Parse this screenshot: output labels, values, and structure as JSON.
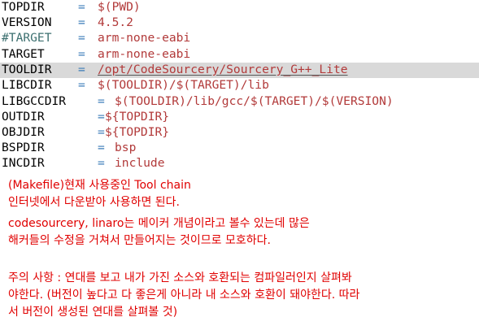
{
  "colors": {
    "variable": "#000000",
    "comment": "#3d7070",
    "operator": "#3a7bb8",
    "value": "#b23a3a",
    "highlight": "#d9d9d9",
    "note_text": "#e00000"
  },
  "editor": {
    "lines": [
      {
        "name": "TOPDIR",
        "op": "=",
        "value": "$(PWD)"
      },
      {
        "name": "VERSION",
        "op": "=",
        "value": "4.5.2"
      },
      {
        "name": "#TARGET",
        "op": "=",
        "value": "arm-none-eabi",
        "comment": true
      },
      {
        "name": "TARGET",
        "op": "=",
        "value": "arm-none-eabi"
      },
      {
        "name": "TOOLDIR",
        "op": "=",
        "value": "/opt/CodeSourcery/Sourcery_G++_Lite",
        "highlighted": true
      },
      {
        "name": "LIBCDIR",
        "op": "=",
        "value": "$(TOOLDIR)/$(TARGET)/lib"
      },
      {
        "name": "LIBGCCDIR",
        "op": "=",
        "value": "$(TOOLDIR)/lib/gcc/$(TARGET)/$(VERSION)"
      },
      {
        "name": "OUTDIR",
        "op": "=",
        "value": "${TOPDIR}"
      },
      {
        "name": "OBJDIR",
        "op": "=",
        "value": "${TOPDIR}"
      },
      {
        "name": "BSPDIR",
        "op": "=",
        "value": "bsp"
      },
      {
        "name": "INCDIR",
        "op": "=",
        "value": "include"
      }
    ]
  },
  "notes": {
    "line1": "(Makefile)현재 사용중인 Tool chain",
    "line2": "인터넷에서 다운받아 사용하면 된다.",
    "line3": "codesourcery, linaro는 메이커 개념이라고 볼수 있는데 많은",
    "line4": "해커들의 수정을 거쳐서 만들어지는 것이므로 모호하다.",
    "line5": "주의 사항 : 연대를 보고 내가 가진 소스와 호환되는 컴파일러인지 살펴봐",
    "line6": "야한다. (버전이 높다고 다 좋은게 아니라 내 소스와 호환이 돼야한다. 따라",
    "line7": "서 버전이 생성된 연대를 살펴볼 것)"
  }
}
